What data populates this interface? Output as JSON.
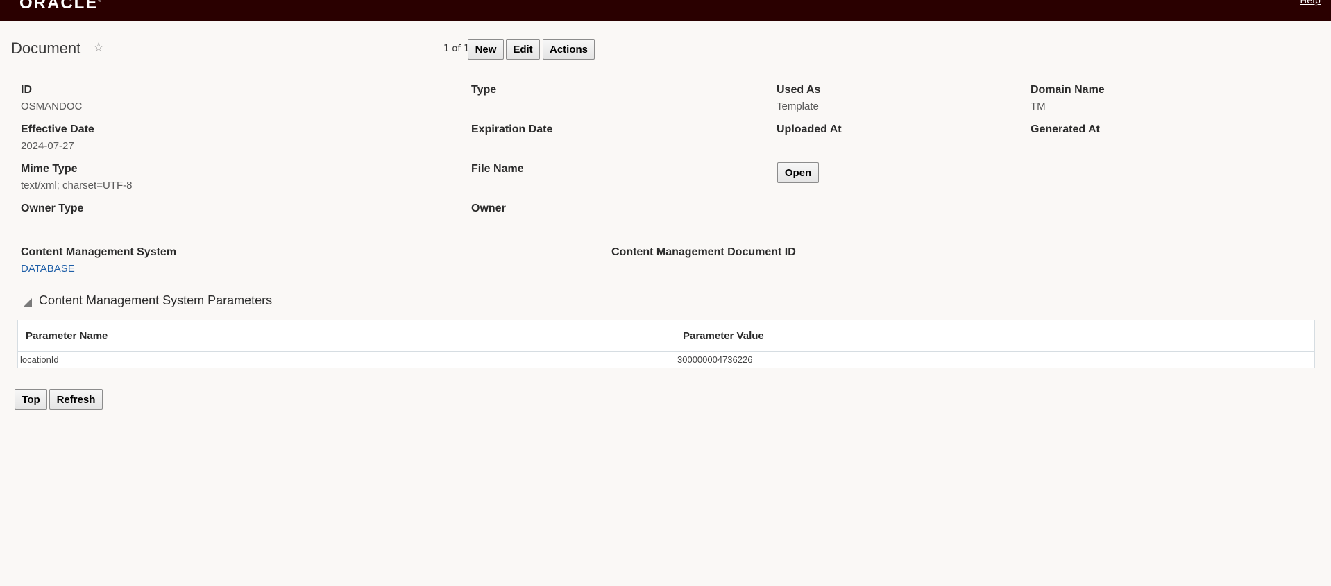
{
  "header": {
    "logo_text": "ORACLE",
    "logo_mark": "®",
    "help_label": "Help"
  },
  "page": {
    "title": "Document",
    "favorite_icon": "star-outline-icon"
  },
  "toolbar": {
    "pager_text": "1 of 1",
    "new_label": "New",
    "edit_label": "Edit",
    "actions_label": "Actions"
  },
  "fields": {
    "id": {
      "label": "ID",
      "value": "OSMANDOC"
    },
    "type": {
      "label": "Type",
      "value": ""
    },
    "used_as": {
      "label": "Used As",
      "value": "Template"
    },
    "domain_name": {
      "label": "Domain Name",
      "value": "TM"
    },
    "effective_date": {
      "label": "Effective Date",
      "value": "2024-07-27"
    },
    "expiration_date": {
      "label": "Expiration Date",
      "value": ""
    },
    "uploaded_at": {
      "label": "Uploaded At",
      "value": ""
    },
    "generated_at": {
      "label": "Generated At",
      "value": ""
    },
    "mime_type": {
      "label": "Mime Type",
      "value": "text/xml; charset=UTF-8"
    },
    "file_name": {
      "label": "File Name",
      "value": ""
    },
    "open_label": "Open",
    "owner_type": {
      "label": "Owner Type",
      "value": ""
    },
    "owner": {
      "label": "Owner",
      "value": ""
    },
    "cms": {
      "label": "Content Management System",
      "value": "DATABASE"
    },
    "cms_doc_id": {
      "label": "Content Management Document ID",
      "value": ""
    }
  },
  "cms_parameters": {
    "section_title": "Content Management System Parameters",
    "columns": [
      "Parameter Name",
      "Parameter Value"
    ],
    "rows": [
      {
        "name": "locationId",
        "value": "300000004736226"
      }
    ]
  },
  "footer": {
    "top_label": "Top",
    "refresh_label": "Refresh"
  },
  "colors": {
    "topbar": "#2a0000",
    "link": "#1f5fa8",
    "background": "#faf8f6"
  }
}
